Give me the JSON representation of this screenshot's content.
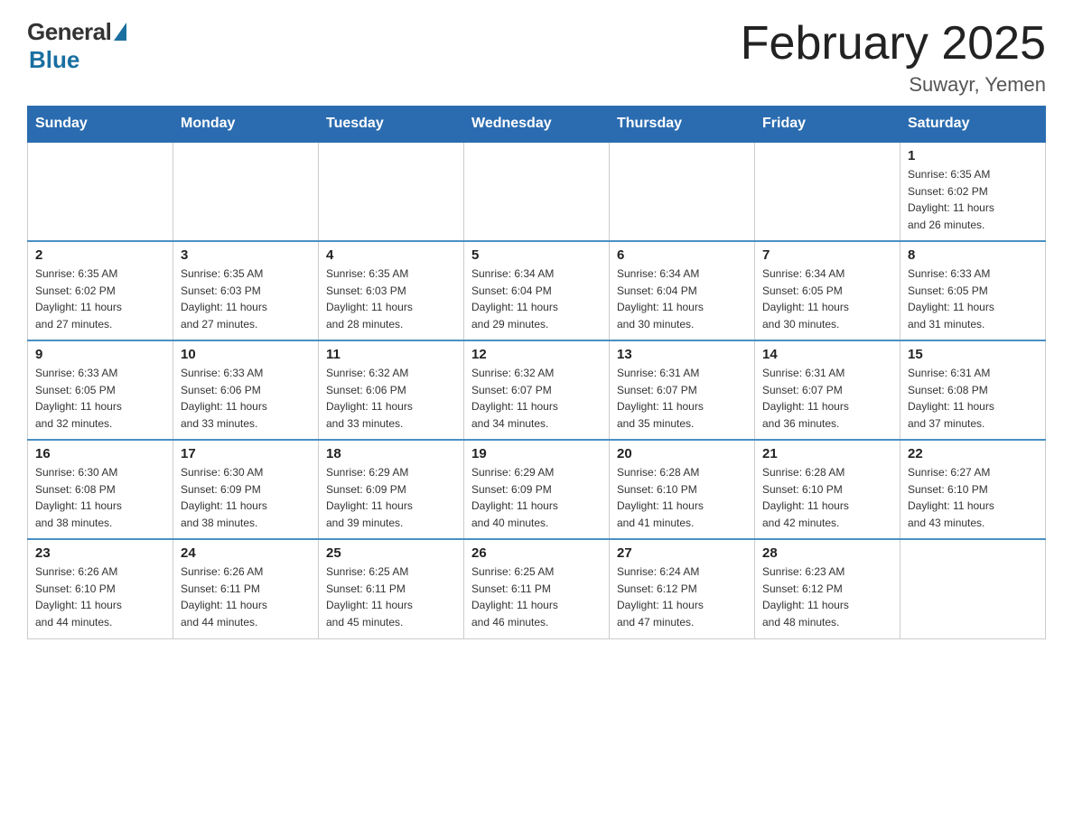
{
  "header": {
    "logo_general": "General",
    "logo_blue": "Blue",
    "month_title": "February 2025",
    "location": "Suwayr, Yemen"
  },
  "days_of_week": [
    "Sunday",
    "Monday",
    "Tuesday",
    "Wednesday",
    "Thursday",
    "Friday",
    "Saturday"
  ],
  "weeks": [
    [
      {
        "day": "",
        "info": ""
      },
      {
        "day": "",
        "info": ""
      },
      {
        "day": "",
        "info": ""
      },
      {
        "day": "",
        "info": ""
      },
      {
        "day": "",
        "info": ""
      },
      {
        "day": "",
        "info": ""
      },
      {
        "day": "1",
        "info": "Sunrise: 6:35 AM\nSunset: 6:02 PM\nDaylight: 11 hours\nand 26 minutes."
      }
    ],
    [
      {
        "day": "2",
        "info": "Sunrise: 6:35 AM\nSunset: 6:02 PM\nDaylight: 11 hours\nand 27 minutes."
      },
      {
        "day": "3",
        "info": "Sunrise: 6:35 AM\nSunset: 6:03 PM\nDaylight: 11 hours\nand 27 minutes."
      },
      {
        "day": "4",
        "info": "Sunrise: 6:35 AM\nSunset: 6:03 PM\nDaylight: 11 hours\nand 28 minutes."
      },
      {
        "day": "5",
        "info": "Sunrise: 6:34 AM\nSunset: 6:04 PM\nDaylight: 11 hours\nand 29 minutes."
      },
      {
        "day": "6",
        "info": "Sunrise: 6:34 AM\nSunset: 6:04 PM\nDaylight: 11 hours\nand 30 minutes."
      },
      {
        "day": "7",
        "info": "Sunrise: 6:34 AM\nSunset: 6:05 PM\nDaylight: 11 hours\nand 30 minutes."
      },
      {
        "day": "8",
        "info": "Sunrise: 6:33 AM\nSunset: 6:05 PM\nDaylight: 11 hours\nand 31 minutes."
      }
    ],
    [
      {
        "day": "9",
        "info": "Sunrise: 6:33 AM\nSunset: 6:05 PM\nDaylight: 11 hours\nand 32 minutes."
      },
      {
        "day": "10",
        "info": "Sunrise: 6:33 AM\nSunset: 6:06 PM\nDaylight: 11 hours\nand 33 minutes."
      },
      {
        "day": "11",
        "info": "Sunrise: 6:32 AM\nSunset: 6:06 PM\nDaylight: 11 hours\nand 33 minutes."
      },
      {
        "day": "12",
        "info": "Sunrise: 6:32 AM\nSunset: 6:07 PM\nDaylight: 11 hours\nand 34 minutes."
      },
      {
        "day": "13",
        "info": "Sunrise: 6:31 AM\nSunset: 6:07 PM\nDaylight: 11 hours\nand 35 minutes."
      },
      {
        "day": "14",
        "info": "Sunrise: 6:31 AM\nSunset: 6:07 PM\nDaylight: 11 hours\nand 36 minutes."
      },
      {
        "day": "15",
        "info": "Sunrise: 6:31 AM\nSunset: 6:08 PM\nDaylight: 11 hours\nand 37 minutes."
      }
    ],
    [
      {
        "day": "16",
        "info": "Sunrise: 6:30 AM\nSunset: 6:08 PM\nDaylight: 11 hours\nand 38 minutes."
      },
      {
        "day": "17",
        "info": "Sunrise: 6:30 AM\nSunset: 6:09 PM\nDaylight: 11 hours\nand 38 minutes."
      },
      {
        "day": "18",
        "info": "Sunrise: 6:29 AM\nSunset: 6:09 PM\nDaylight: 11 hours\nand 39 minutes."
      },
      {
        "day": "19",
        "info": "Sunrise: 6:29 AM\nSunset: 6:09 PM\nDaylight: 11 hours\nand 40 minutes."
      },
      {
        "day": "20",
        "info": "Sunrise: 6:28 AM\nSunset: 6:10 PM\nDaylight: 11 hours\nand 41 minutes."
      },
      {
        "day": "21",
        "info": "Sunrise: 6:28 AM\nSunset: 6:10 PM\nDaylight: 11 hours\nand 42 minutes."
      },
      {
        "day": "22",
        "info": "Sunrise: 6:27 AM\nSunset: 6:10 PM\nDaylight: 11 hours\nand 43 minutes."
      }
    ],
    [
      {
        "day": "23",
        "info": "Sunrise: 6:26 AM\nSunset: 6:10 PM\nDaylight: 11 hours\nand 44 minutes."
      },
      {
        "day": "24",
        "info": "Sunrise: 6:26 AM\nSunset: 6:11 PM\nDaylight: 11 hours\nand 44 minutes."
      },
      {
        "day": "25",
        "info": "Sunrise: 6:25 AM\nSunset: 6:11 PM\nDaylight: 11 hours\nand 45 minutes."
      },
      {
        "day": "26",
        "info": "Sunrise: 6:25 AM\nSunset: 6:11 PM\nDaylight: 11 hours\nand 46 minutes."
      },
      {
        "day": "27",
        "info": "Sunrise: 6:24 AM\nSunset: 6:12 PM\nDaylight: 11 hours\nand 47 minutes."
      },
      {
        "day": "28",
        "info": "Sunrise: 6:23 AM\nSunset: 6:12 PM\nDaylight: 11 hours\nand 48 minutes."
      },
      {
        "day": "",
        "info": ""
      }
    ]
  ]
}
